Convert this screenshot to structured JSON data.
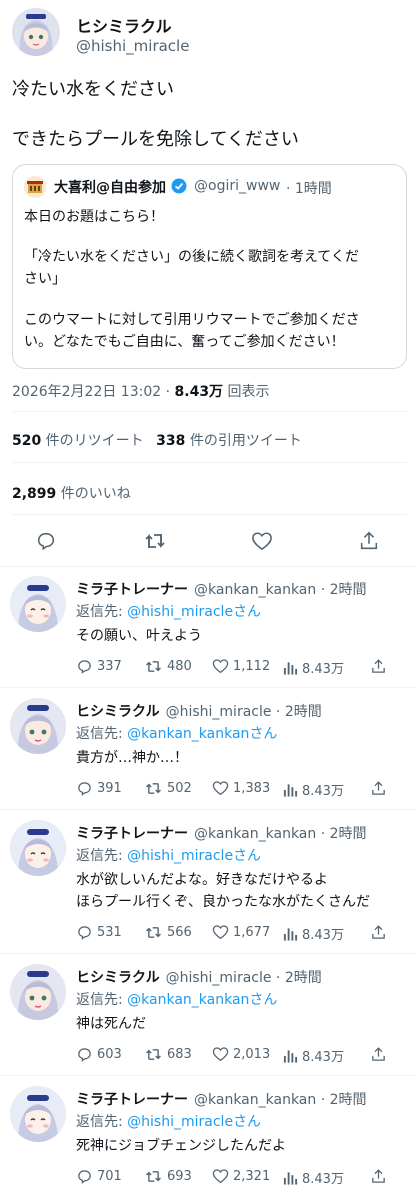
{
  "main_tweet": {
    "author_name": "ヒシミラクル",
    "author_handle": "@hishi_miracle",
    "text_line1": "冷たい水をください",
    "text_line2": "できたらプールを免除してください",
    "quoted": {
      "author_name": "大喜利@自由参加",
      "author_handle": "@ogiri_www",
      "time": "· 1時間",
      "line1": "本日のお題はこちら！",
      "line2": "「冷たい水をください」の後に続く歌詞を考えてくだ",
      "line3": "さい」",
      "line4": "このウマートに対して引用リウマートでご参加くださ",
      "line5": "い。どなたでもご自由に、奮ってご参加ください！"
    },
    "timestamp": "2026年2月22日 13:02",
    "separator": " · ",
    "views_count": "8.43万",
    "views_label": " 回表示",
    "retweets_count": "520",
    "retweets_label": " 件のリツイート",
    "quotes_count": "338",
    "quotes_label": " 件の引用ツイート",
    "likes_count": "2,899",
    "likes_label": " 件のいいね"
  },
  "replying_prefix": "返信先: ",
  "replying_suffix": "さん",
  "replies": [
    {
      "name": "ミラ子トレーナー",
      "handle": "@kankan_kankan · 2時間",
      "reply_to": "@hishi_miracle",
      "lines": [
        "その願い、叶えよう"
      ],
      "replies": "337",
      "retweets": "480",
      "likes": "1,112",
      "views": "8.43万",
      "avatar": "trainer"
    },
    {
      "name": "ヒシミラクル",
      "handle": "@hishi_miracle · 2時間",
      "reply_to": "@kankan_kankan",
      "lines": [
        "貴方が…神か…！"
      ],
      "replies": "391",
      "retweets": "502",
      "likes": "1,383",
      "views": "8.43万",
      "avatar": "hishi"
    },
    {
      "name": "ミラ子トレーナー",
      "handle": "@kankan_kankan · 2時間",
      "reply_to": "@hishi_miracle",
      "lines": [
        "水が欲しいんだよな。好きなだけやるよ",
        "ほらプール行くぞ、良かったな水がたくさんだ"
      ],
      "replies": "531",
      "retweets": "566",
      "likes": "1,677",
      "views": "8.43万",
      "avatar": "trainer"
    },
    {
      "name": "ヒシミラクル",
      "handle": "@hishi_miracle · 2時間",
      "reply_to": "@kankan_kankan",
      "lines": [
        "神は死んだ"
      ],
      "replies": "603",
      "retweets": "683",
      "likes": "2,013",
      "views": "8.43万",
      "avatar": "hishi"
    },
    {
      "name": "ミラ子トレーナー",
      "handle": "@kankan_kankan · 2時間",
      "reply_to": "@hishi_miracle",
      "lines": [
        "死神にジョブチェンジしたんだよ"
      ],
      "replies": "701",
      "retweets": "693",
      "likes": "2,321",
      "views": "8.43万",
      "avatar": "trainer"
    }
  ],
  "colors": {
    "accent": "#1d9bf0",
    "text": "#0f1419",
    "muted": "#536471",
    "border": "#eff3f4"
  }
}
